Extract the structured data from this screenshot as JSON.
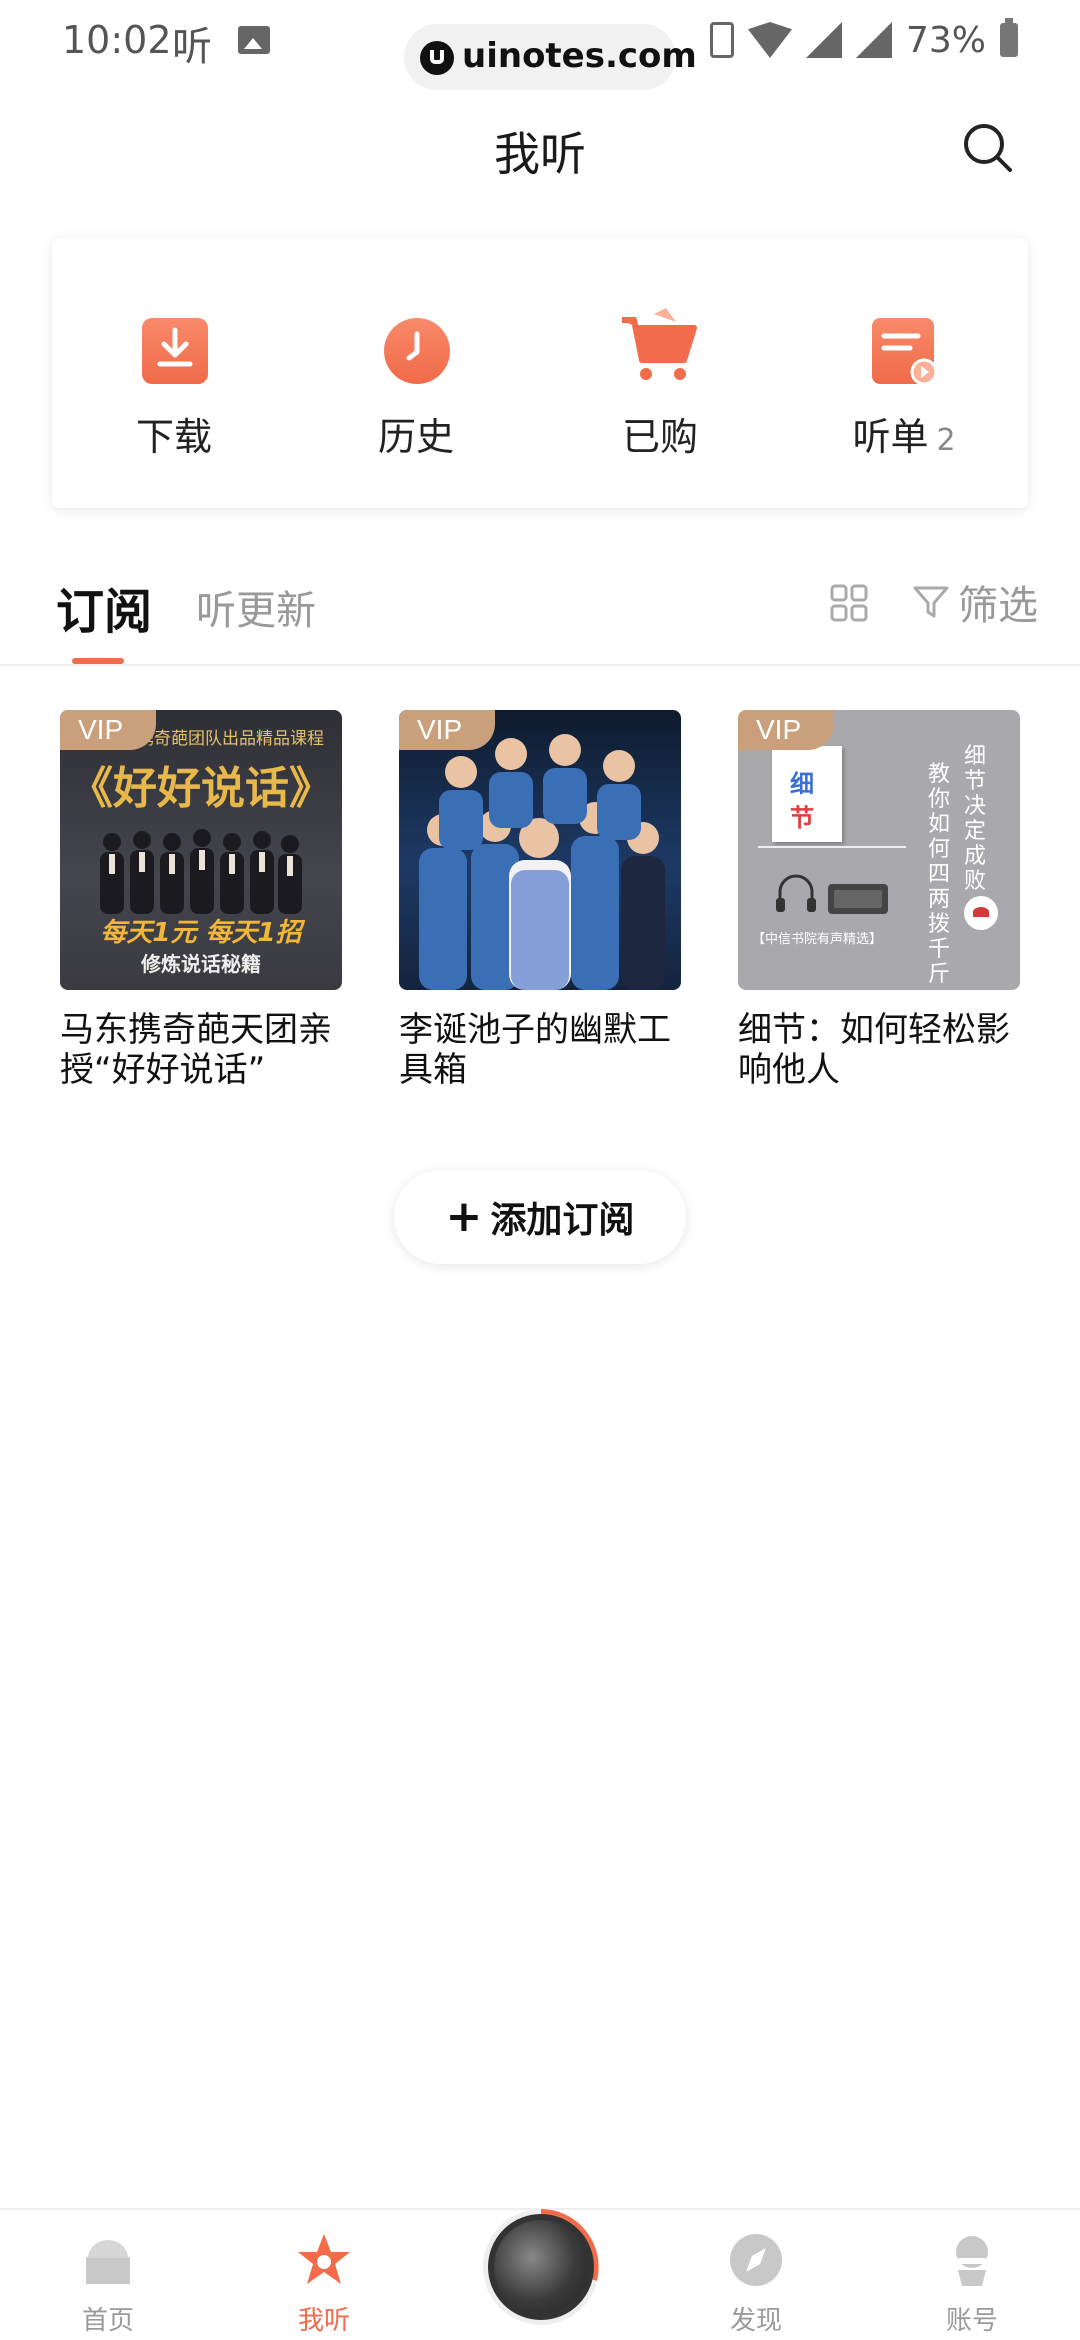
{
  "status_bar": {
    "time": "10:02",
    "app_glyph": "听",
    "url": "uinotes.com",
    "battery": "73%"
  },
  "header": {
    "title": "我听",
    "search_icon": "search-icon"
  },
  "quick_actions": [
    {
      "label": "下载",
      "icon": "download-icon"
    },
    {
      "label": "历史",
      "icon": "clock-icon"
    },
    {
      "label": "已购",
      "icon": "cart-icon"
    },
    {
      "label": "听单",
      "badge": "2",
      "icon": "playlist-icon"
    }
  ],
  "tabs": {
    "active": "订阅",
    "inactive": "听更新",
    "filter_label": "筛选"
  },
  "subscriptions": [
    {
      "title": "马东携奇葩天团亲授“好好说话”",
      "vip": "VIP",
      "cover": {
        "top_text": "东携奇葩团队出品精品课程",
        "title": "《好好说话》",
        "slogan": "每天1元 每天1招",
        "subtitle": "修炼说话秘籍"
      }
    },
    {
      "title": "李诞池子的幽默工具箱",
      "vip": "VIP"
    },
    {
      "title": "细节：如何轻松影响他人",
      "vip": "VIP",
      "cover": {
        "book_line1": "细",
        "book_line2": "节",
        "vertical1": "细节决定成败",
        "vertical2": "教你如何四两拨千斤",
        "caption": "【中信书院有声精选】"
      }
    }
  ],
  "add_button": {
    "plus": "+",
    "label": "添加订阅"
  },
  "bottom_nav": [
    {
      "label": "首页",
      "icon": "home-icon",
      "active": false
    },
    {
      "label": "我听",
      "icon": "star-icon",
      "active": true
    },
    {
      "label": "发现",
      "icon": "compass-icon",
      "active": false
    },
    {
      "label": "账号",
      "icon": "user-icon",
      "active": false
    }
  ],
  "colors": {
    "accent": "#f26b4a",
    "vip": "#c9a07b",
    "muted": "#999999"
  }
}
